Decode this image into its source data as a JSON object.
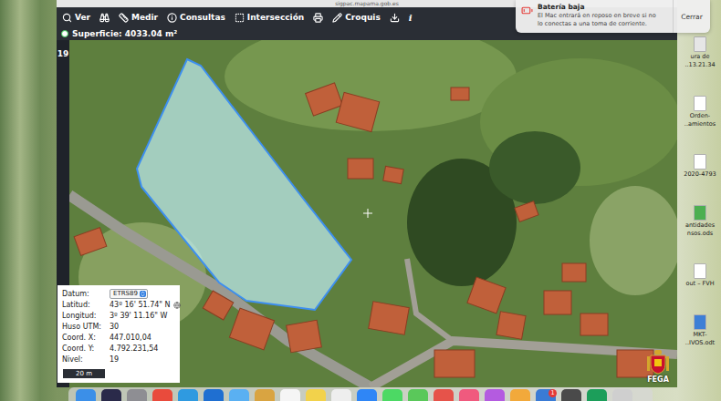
{
  "browser": {
    "url": "sigpac.mapama.gob.es"
  },
  "toolbar": [
    {
      "kind": "search",
      "label": "Ver"
    },
    {
      "kind": "binoculars"
    },
    {
      "kind": "ruler",
      "label": "Medir"
    },
    {
      "kind": "info",
      "label": "Consultas"
    },
    {
      "kind": "intersection",
      "label": "Intersección"
    },
    {
      "kind": "printer"
    },
    {
      "kind": "pencil",
      "label": "Croquis"
    },
    {
      "kind": "download"
    },
    {
      "kind": "glyph",
      "label": "i"
    }
  ],
  "area": {
    "label": "Superficie: 4033.04 m²"
  },
  "zoom": "19",
  "coordinates": {
    "rows": [
      {
        "kind": "select",
        "label": "Datum:",
        "value": "ETRS89"
      },
      {
        "kind": "text",
        "label": "Latitud:",
        "value": "43º 16' 51.74\" N"
      },
      {
        "kind": "text",
        "label": "Longitud:",
        "value": "3º 39' 11.16\" W"
      },
      {
        "kind": "text",
        "label": "Huso UTM:",
        "value": "30"
      },
      {
        "kind": "text",
        "label": "Coord. X:",
        "value": "447.010,04"
      },
      {
        "kind": "text",
        "label": "Coord. Y:",
        "value": "4.792.231,54"
      },
      {
        "kind": "text",
        "label": "Nivel:",
        "value": "19"
      }
    ],
    "scale": "20 m"
  },
  "logo": "FEGA",
  "notification": {
    "title": "Batería baja",
    "body": [
      "El Mac entrará en reposo en breve si no",
      "lo conectas a una toma de corriente."
    ],
    "button": "Cerrar"
  },
  "desktop_files": [
    {
      "lines": [
        "ura de",
        "..13.21.34"
      ],
      "color": "#e6e6e6"
    },
    {
      "lines": [
        "Orden-",
        "..amientos"
      ],
      "color": "#ffffff"
    },
    {
      "lines": [
        "2020-4793"
      ],
      "color": "#ffffff"
    },
    {
      "lines": [
        "antidades",
        "nsos.ods"
      ],
      "color": "#4caf50"
    },
    {
      "lines": [
        "out – FVH"
      ],
      "color": "#ffffff"
    },
    {
      "lines": [
        "MKT-",
        "..IVOS.odt"
      ],
      "color": "#3d7fd6"
    }
  ],
  "dock": [
    {
      "color": "#3b8fe8",
      "badge": ""
    },
    {
      "color": "#2a2a4a",
      "badge": ""
    },
    {
      "color": "#8e8e93",
      "badge": ""
    },
    {
      "color": "#e94b3c",
      "badge": ""
    },
    {
      "color": "#2f9ae0",
      "badge": ""
    },
    {
      "color": "#1f6fd1",
      "badge": ""
    },
    {
      "color": "#5ab0f2",
      "badge": ""
    },
    {
      "color": "#d9a441",
      "badge": ""
    },
    {
      "color": "#f5f5f5",
      "badge": ""
    },
    {
      "color": "#f2d24b",
      "badge": ""
    },
    {
      "color": "#eeeeee",
      "badge": ""
    },
    {
      "color": "#2f86f6",
      "badge": ""
    },
    {
      "color": "#4cd964",
      "badge": ""
    },
    {
      "color": "#5ac85a",
      "badge": ""
    },
    {
      "color": "#e6534a",
      "badge": ""
    },
    {
      "color": "#f05a7e",
      "badge": ""
    },
    {
      "color": "#b45be0",
      "badge": ""
    },
    {
      "color": "#f2a93b",
      "badge": ""
    },
    {
      "color": "#3a7bd5",
      "badge": "1"
    },
    {
      "color": "#4a4a4a",
      "badge": ""
    },
    {
      "color": "#1c9e5a",
      "badge": ""
    },
    {
      "color": "#cfcfcf",
      "badge": ""
    }
  ]
}
